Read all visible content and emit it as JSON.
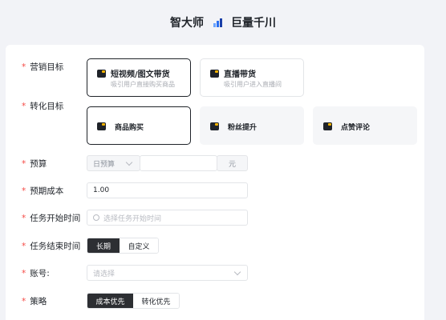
{
  "header": {
    "left_title": "智大师",
    "right_title": "巨量千川",
    "logo_icon": "ocean-engine-logo-icon"
  },
  "form": {
    "required_mark": "*",
    "marketing_goal": {
      "label": "营销目标",
      "options": [
        {
          "title": "短视频/图文带货",
          "subtitle": "吸引用户直接购买商品",
          "selected": true
        },
        {
          "title": "直播带货",
          "subtitle": "吸引用户进入直播间",
          "selected": false
        }
      ]
    },
    "conversion_goal": {
      "label": "转化目标",
      "options": [
        {
          "title": "商品购买",
          "selected": true
        },
        {
          "title": "粉丝提升",
          "selected": false
        },
        {
          "title": "点赞评论",
          "selected": false
        }
      ]
    },
    "budget": {
      "label": "预算",
      "type_value": "日预算",
      "value": "",
      "unit": "元"
    },
    "expected_cost": {
      "label": "预期成本",
      "value": "1.00"
    },
    "start_time": {
      "label": "任务开始时间",
      "placeholder": "选择任务开始时间"
    },
    "end_time": {
      "label": "任务结束时间",
      "options": [
        "长期",
        "自定义"
      ],
      "active": 0
    },
    "account": {
      "label": "账号:",
      "placeholder": "请选择"
    },
    "strategy": {
      "label": "策略",
      "options": [
        "成本优先",
        "转化优先"
      ],
      "active": 0
    }
  },
  "colors": {
    "accent": "#1f2329",
    "required": "#f54a45",
    "brand": "#2a6ff0",
    "icon_yellow": "#f5b300"
  }
}
